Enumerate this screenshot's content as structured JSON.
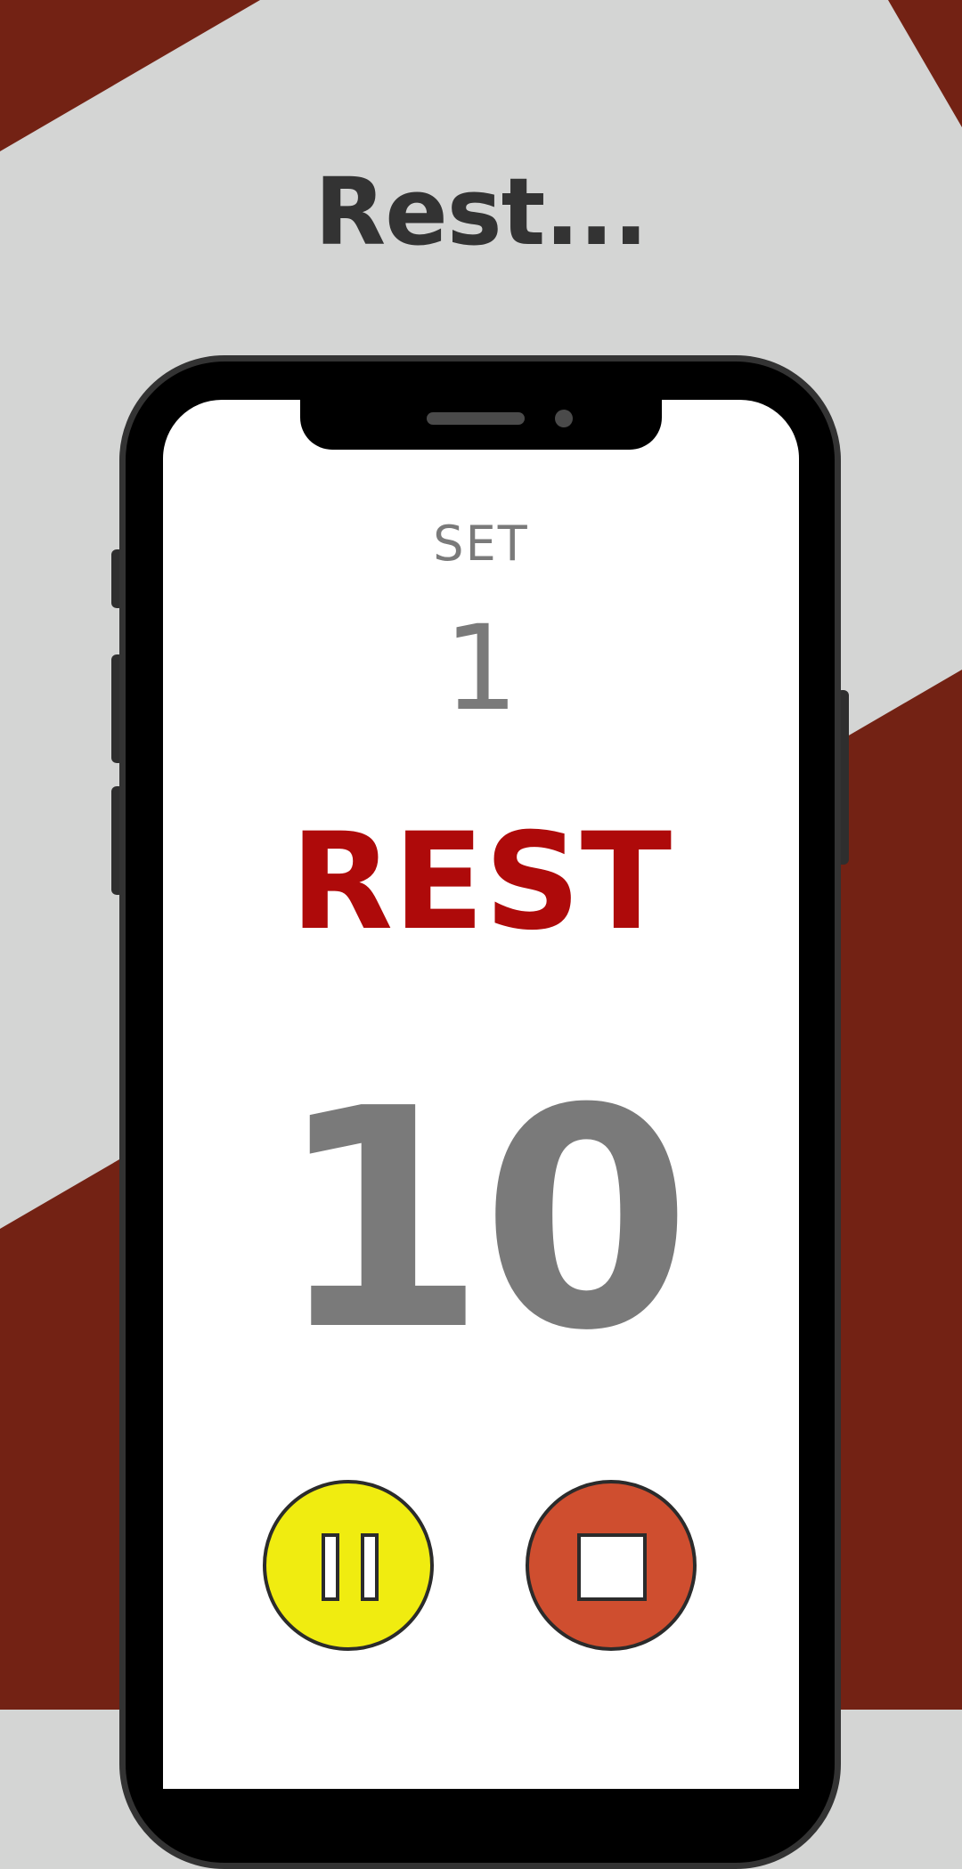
{
  "headline": "Rest...",
  "workout": {
    "set_label": "SET",
    "set_number": "1",
    "phase_label": "REST",
    "countdown": "10"
  },
  "controls": {
    "pause_icon": "pause-icon",
    "stop_icon": "stop-icon"
  },
  "colors": {
    "background_light": "#d4d5d4",
    "background_accent": "#732214",
    "headline_text": "#333333",
    "phase_red": "#ae0a0a",
    "timer_gray": "#7a7a7a",
    "pause_yellow": "#f0ec10",
    "stop_orange": "#cf4e2f"
  }
}
